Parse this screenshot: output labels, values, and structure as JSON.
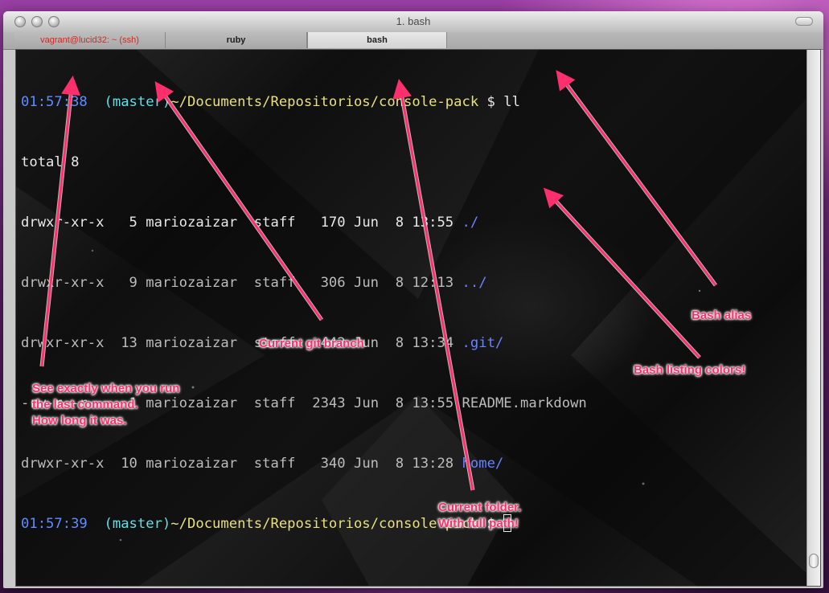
{
  "window": {
    "title": "1. bash"
  },
  "tabs": [
    {
      "label": "vagrant@lucid32: ~ (ssh)"
    },
    {
      "label": "ruby"
    },
    {
      "label": "bash"
    }
  ],
  "terminal": {
    "prompt1": {
      "time": "01:57:38",
      "branch": "(master)",
      "path": "~/Documents/Repositorios/console-pack",
      "symbol": "$",
      "command": "ll"
    },
    "total": "total 8",
    "rows": [
      {
        "perm": "drwxr-xr-x",
        "links": "5",
        "owner": "mariozaizar",
        "group": "staff",
        "size": "170",
        "date": "Jun  8 13:55",
        "name": "./"
      },
      {
        "perm": "drwxr-xr-x",
        "links": "9",
        "owner": "mariozaizar",
        "group": "staff",
        "size": "306",
        "date": "Jun  8 12:13",
        "name": "../"
      },
      {
        "perm": "drwxr-xr-x",
        "links": "13",
        "owner": "mariozaizar",
        "group": "staff",
        "size": "442",
        "date": "Jun  8 13:34",
        "name": ".git/"
      },
      {
        "perm": "-rw-r--r--",
        "links": "1",
        "owner": "mariozaizar",
        "group": "staff",
        "size": "2343",
        "date": "Jun  8 13:55",
        "name": "README.markdown"
      },
      {
        "perm": "drwxr-xr-x",
        "links": "10",
        "owner": "mariozaizar",
        "group": "staff",
        "size": "340",
        "date": "Jun  8 13:28",
        "name": "home/"
      }
    ],
    "prompt2": {
      "time": "01:57:39",
      "branch": "(master)",
      "path": "~/Documents/Repositorios/console-pack",
      "symbol": "$"
    }
  },
  "annotations": {
    "time_note": "See exactly when you run\nthe last command.\nHow long it was.",
    "branch_note": "Current git branch",
    "folder_note": "Current folder.\nWith full path!",
    "alias_note": "Bash alias",
    "colors_note": "Bash listing colors!"
  },
  "colors": {
    "time": "#5f8cff",
    "branch": "#5fe0e8",
    "path": "#e9e07a",
    "directory": "#6b83ff",
    "annotation": "#ff2f6e",
    "ssh_tab": "#d8261f"
  }
}
